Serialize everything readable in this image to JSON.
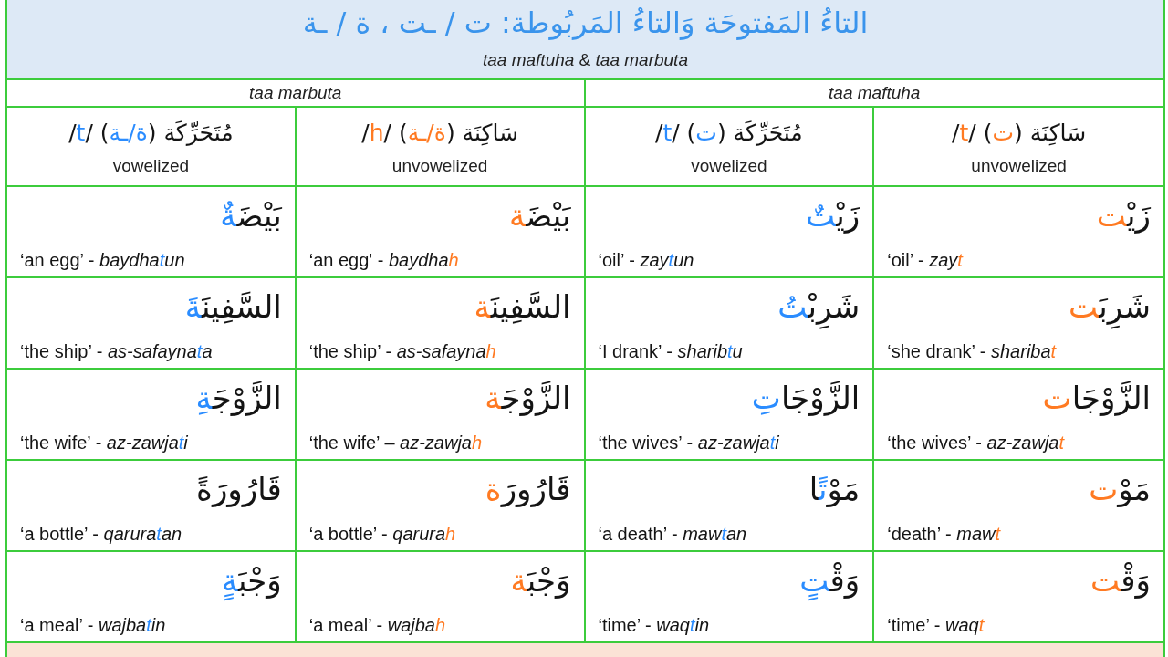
{
  "title": "التاءُ المَفتوحَة وَالتاءُ المَربُوطة: ت / ـت ، ة / ـة",
  "subtitle": "*taa maftuha* & *taa marbuta*",
  "groups": [
    {
      "label": "taa maftuha"
    },
    {
      "label": "taa marbuta"
    }
  ],
  "columns": [
    {
      "color": "#ff7a22",
      "caption": "unvowelized",
      "heading": {
        "word": "سَاكِنَة (",
        "letters": "ت",
        "middle": ") /",
        "sound": "t",
        "after": "/"
      }
    },
    {
      "color": "#2a8cff",
      "caption": "vowelized",
      "heading": {
        "word": "مُتَحَرِّكَة (",
        "letters": "ت",
        "middle": ") /",
        "sound": "t",
        "after": "/"
      }
    },
    {
      "color": "#ff7a22",
      "caption": "unvowelized",
      "heading": {
        "word": "سَاكِنَة (",
        "letters": "ة/ـة",
        "middle": ") /",
        "sound": "h",
        "after": "/"
      }
    },
    {
      "color": "#2a8cff",
      "caption": "vowelized",
      "heading": {
        "word": "مُتَحَرِّكَة (",
        "letters": "ة/ـة",
        "middle": ") /",
        "sound": "t",
        "after": "/"
      }
    }
  ],
  "rows": [
    {
      "cells": [
        {
          "word": {
            "stem": "زَيْ",
            "letter": "ت"
          },
          "gloss": "‘oil’ -",
          "translit": {
            "stem": "zay",
            "letter": "t"
          }
        },
        {
          "word": {
            "stem": "زَيْ",
            "letter": "تٌ"
          },
          "gloss": "‘oil’ -",
          "translit": {
            "stem": "zay",
            "letter": "t",
            "ending": "un"
          }
        },
        {
          "word": {
            "stem": "بَيْضَ",
            "letter": "ة"
          },
          "gloss": "‘an egg' -",
          "translit": {
            "stem": "baydha",
            "letter": "h"
          }
        },
        {
          "word": {
            "stem": "بَيْضَ",
            "letter": "ةٌ"
          },
          "gloss": "‘an egg’ -",
          "translit": {
            "stem": "baydha",
            "letter": "t",
            "ending": "un"
          }
        }
      ]
    },
    {
      "cells": [
        {
          "word": {
            "stem": "شَرِبَ",
            "letter": "ت"
          },
          "gloss": "‘she drank’ -",
          "translit": {
            "stem": "shariba",
            "letter": "t"
          }
        },
        {
          "word": {
            "stem": "شَرِبْ",
            "letter": "تُ"
          },
          "gloss": "‘I drank’ -",
          "translit": {
            "stem": "sharib",
            "letter": "t",
            "ending": "u"
          }
        },
        {
          "word": {
            "stem": "السَّفِينَ",
            "letter": "ة"
          },
          "gloss": "‘the ship’ -",
          "translit": {
            "stem": "as-safayna",
            "letter": "h"
          }
        },
        {
          "word": {
            "stem": "السَّفِينَ",
            "letter": "ةَ"
          },
          "gloss": "‘the ship’ -",
          "translit": {
            "stem": "as-safayna",
            "letter": "t",
            "ending": "a"
          }
        }
      ]
    },
    {
      "cells": [
        {
          "word": {
            "stem": "الزَّوْجَا",
            "letter": "ت"
          },
          "gloss": "‘the wives’ -",
          "translit": {
            "stem": "az-zawja",
            "letter": "t"
          }
        },
        {
          "word": {
            "stem": "الزَّوْجَا",
            "letter": "تِ"
          },
          "gloss": "‘the wives’ -",
          "translit": {
            "stem": "az-zawja",
            "letter": "t",
            "ending": "i"
          }
        },
        {
          "word": {
            "stem": "الزَّوْجَ",
            "letter": "ة"
          },
          "gloss": "‘the wife’ –",
          "translit": {
            "stem": "az-zawja",
            "letter": "h"
          }
        },
        {
          "word": {
            "stem": "الزَّوْجَ",
            "letter": "ةِ"
          },
          "gloss": "‘the wife’ -",
          "translit": {
            "stem": "az-zawja",
            "letter": "t",
            "ending": "i"
          }
        }
      ]
    },
    {
      "cells": [
        {
          "word": {
            "stem": "مَوْ",
            "letter": "ت"
          },
          "gloss": "‘death’ -",
          "translit": {
            "stem": "maw",
            "letter": "t"
          }
        },
        {
          "word": {
            "stem": "مَوْ",
            "letter": "تً",
            "ending": "ا"
          },
          "gloss": "‘a death’ -",
          "translit": {
            "stem": "maw",
            "letter": "t",
            "ending": "an"
          }
        },
        {
          "word": {
            "stem": "قَارُورَ",
            "letter": "ة"
          },
          "gloss": "‘a bottle’ -",
          "translit": {
            "stem": "qarura",
            "letter": "h"
          }
        },
        {
          "word": {
            "stem": "قَارُورَةً"
          },
          "gloss": "‘a bottle’ -",
          "translit": {
            "stem": "qarura",
            "letter": "t",
            "ending": "an"
          }
        }
      ]
    },
    {
      "cells": [
        {
          "word": {
            "stem": "وَقْ",
            "letter": "ت"
          },
          "gloss": "‘time’ -",
          "translit": {
            "stem": "waq",
            "letter": "t"
          }
        },
        {
          "word": {
            "stem": "وَقْ",
            "letter": "تٍ"
          },
          "gloss": "‘time’ -",
          "translit": {
            "stem": "waq",
            "letter": "t",
            "ending": "in"
          }
        },
        {
          "word": {
            "stem": "وَجْبَ",
            "letter": "ة"
          },
          "gloss": "‘a meal’ -",
          "translit": {
            "stem": "wajba",
            "letter": "h"
          }
        },
        {
          "word": {
            "stem": "وَجْبَ",
            "letter": "ةٍ"
          },
          "gloss": "‘a meal’ -",
          "translit": {
            "stem": "wajba",
            "letter": "t",
            "ending": "in"
          }
        }
      ]
    }
  ]
}
